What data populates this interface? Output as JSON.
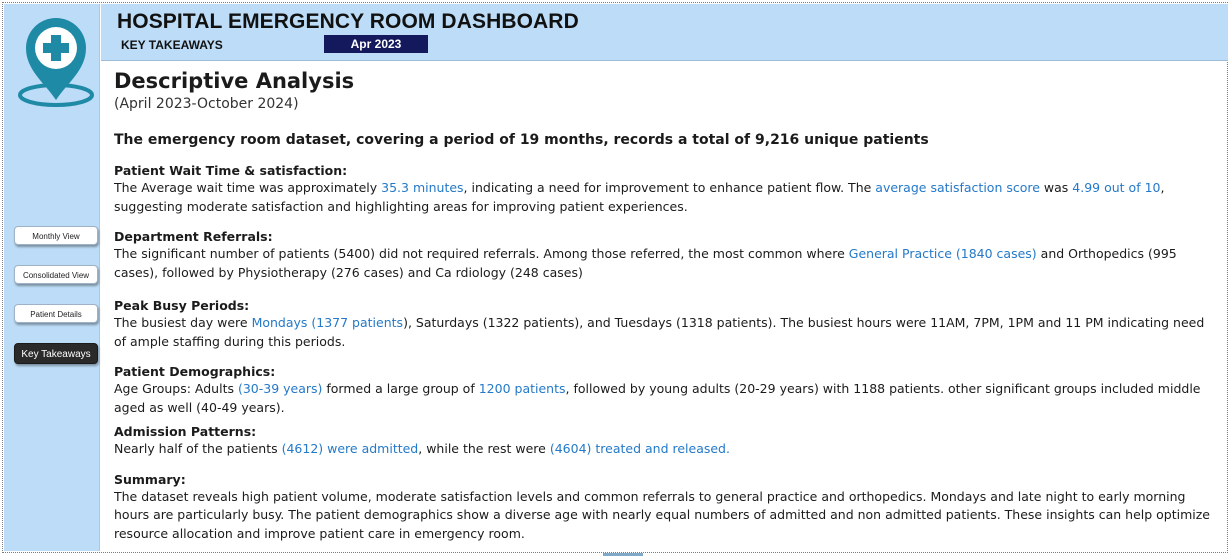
{
  "header": {
    "title": "HOSPITAL EMERGENCY ROOM DASHBOARD",
    "subtitle": "KEY TAKEAWAYS",
    "date_badge": "Apr 2023"
  },
  "sidebar": {
    "logo_icon": "hospital-location-pin-icon",
    "nav": [
      {
        "label": "Monthly View"
      },
      {
        "label": "Consolidated View"
      },
      {
        "label": "Patient Details"
      },
      {
        "label": "Key Takeaways",
        "active": true
      }
    ]
  },
  "content": {
    "title": "Descriptive Analysis",
    "period": "(April 2023-October 2024)",
    "headline": "The emergency room dataset, covering a period of 19 months, records a total of 9,216 unique patients",
    "sections": {
      "wait": {
        "heading": "Patient Wait Time & satisfaction:",
        "t1": "The Average wait time was approximately ",
        "h1": "35.3 minutes",
        "t2": ", indicating a need for improvement to enhance patient flow. The ",
        "h2": "average satisfaction score",
        "t3": " was ",
        "h3": "4.99 out of 10",
        "t4": ", suggesting moderate satisfaction and highlighting areas for improving patient experiences."
      },
      "referrals": {
        "heading": "Department Referrals:",
        "t1": "The significant number of patients (5400) did not required referrals. Among those referred, the most common where ",
        "h1": "General Practice (1840 cases)",
        "t2": " and Orthopedics (995 cases), followed by Physiotherapy (276 cases) and Ca rdiology (248 cases)"
      },
      "busy": {
        "heading": "Peak Busy Periods:",
        "t1": "The busiest day were ",
        "h1": "Mondays (1377 patients",
        "t2": "), Saturdays (1322 patients), and Tuesdays (1318 patients). The busiest hours were 11AM, 7PM, 1PM and 11 PM indicating need of ample staffing during this periods."
      },
      "demographics": {
        "heading": "Patient Demographics:",
        "t1": "Age Groups: Adults ",
        "h1": "(30-39 years)",
        "t2": " formed a large group of ",
        "h2": "1200 patients",
        "t3": ", followed by young adults (20-29 years) with 1188 patients. other significant groups included middle aged as well (40-49 years)."
      },
      "admission": {
        "heading": "Admission Patterns:",
        "t1": "Nearly half of the patients ",
        "h1": "(4612) were admitted",
        "t2": ", while the rest were ",
        "h2": "(4604) treated and released."
      },
      "summary": {
        "heading": "Summary:",
        "text": "The dataset reveals high patient volume, moderate satisfaction levels and common referrals to general practice and orthopedics. Mondays and late night to early morning hours are particularly busy. The patient demographics show a diverse age with nearly equal numbers of admitted and non admitted patients. These insights can help optimize resource allocation and improve patient care in emergency room."
      }
    }
  },
  "colors": {
    "panel_bg": "#bcdcf7",
    "date_badge_bg": "#13195c",
    "highlight": "#2479c8",
    "active_nav_bg": "#2a2a2a",
    "logo_teal": "#1e8aa6"
  }
}
